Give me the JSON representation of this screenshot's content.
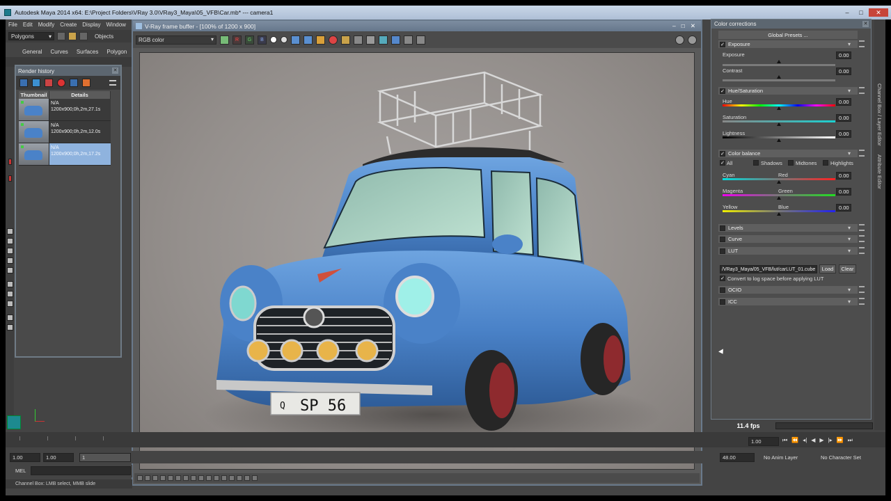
{
  "maya": {
    "title": "Autodesk Maya 2014 x64: E:\\Project Folders\\VRay 3.0\\VRay3_Maya\\05_VFB\\Car.mb*   ---   camera1",
    "menu": [
      "File",
      "Edit",
      "Modify",
      "Create",
      "Display",
      "Window"
    ],
    "mode_selector": "Polygons",
    "objects_label": "Objects",
    "shelf_tabs": [
      "General",
      "Curves",
      "Surfaces",
      "Polygon"
    ]
  },
  "render_history": {
    "title": "Render history",
    "columns": [
      "Thumbnail",
      "Details"
    ],
    "rows": [
      {
        "line1": "N/A",
        "line2": "1200x900;0h,2m,27.1s",
        "selected": false
      },
      {
        "line1": "N/A",
        "line2": "1200x900;0h,2m,12.0s",
        "selected": false
      },
      {
        "line1": "N/A",
        "line2": "1200x900;0h,2m,17.2s",
        "selected": true
      }
    ]
  },
  "vfb": {
    "title": "V-Ray frame buffer - [100% of 1200 x 900]",
    "channel": "RGB color",
    "r_label": "R",
    "g_label": "G",
    "b_label": "B",
    "plate_text": "SP 56",
    "plate_prefix": "Q"
  },
  "color_corrections": {
    "title": "Color corrections",
    "global_presets": "Global Presets ...",
    "exposure": {
      "header": "Exposure",
      "enabled": true,
      "exposure_label": "Exposure",
      "exposure_value": "0.00",
      "contrast_label": "Contrast",
      "contrast_value": "0.00"
    },
    "hue_saturation": {
      "header": "Hue/Saturation",
      "enabled": true,
      "hue_label": "Hue",
      "hue_value": "0.00",
      "saturation_label": "Saturation",
      "saturation_value": "0.00",
      "lightness_label": "Lightness",
      "lightness_value": "0.00"
    },
    "color_balance": {
      "header": "Color balance",
      "enabled": true,
      "modes": {
        "all": "All",
        "shadows": "Shadows",
        "midtones": "Midtones",
        "highlights": "Highlights"
      },
      "cyan": "Cyan",
      "red": "Red",
      "cyan_red_value": "0.00",
      "magenta": "Magenta",
      "green": "Green",
      "magenta_green_value": "0.00",
      "yellow": "Yellow",
      "blue": "Blue",
      "yellow_blue_value": "0.00"
    },
    "levels": "Levels",
    "curve": "Curve",
    "lut": "LUT",
    "lut_path": "/VRay3_Maya/05_VFB/lut/carLUT_01.cube",
    "load": "Load",
    "clear": "Clear",
    "log_space": "Convert to log space before applying LUT",
    "ocio": "OCIO",
    "icc": "ICC"
  },
  "right_tabs": [
    "Channel Box / Layer Editor",
    "Attribute Editor"
  ],
  "bottom": {
    "fps": "11.4 fps",
    "current_frame": "1.00",
    "start_time": "1.00",
    "playback_start": "1.00",
    "range_start_field": "1",
    "end_time": "48.00",
    "anim_layer": "No Anim Layer",
    "character_set": "No Character Set",
    "mel_label": "MEL",
    "help": "Channel Box: LMB select, MMB slide"
  },
  "colors": {
    "car_body": "#4a82c8",
    "titlebar": "#aebfd6",
    "selection": "#8fb3de"
  }
}
